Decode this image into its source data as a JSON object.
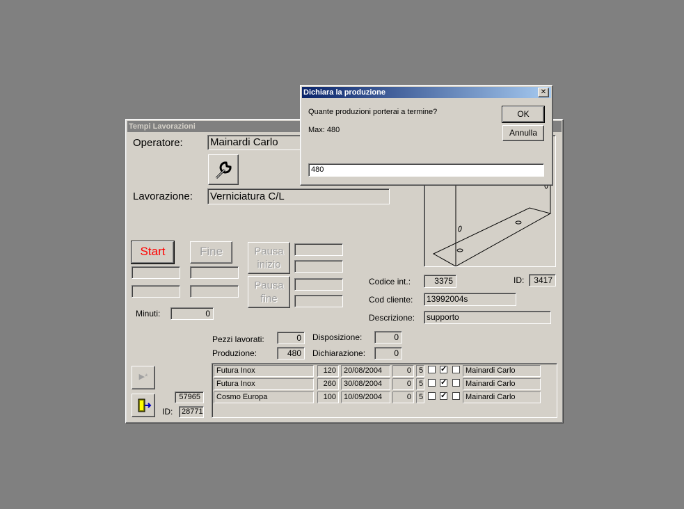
{
  "main": {
    "title": "Tempi Lavorazioni",
    "operatore_label": "Operatore:",
    "operatore_value": "Mainardi Carlo",
    "lavorazione_label": "Lavorazione:",
    "lavorazione_value": "Verniciatura C/L",
    "start_label": "Start",
    "fine_label": "Fine",
    "pausa_inizio_label": "Pausa\ninizio",
    "pausa_fine_label": "Pausa\nfine",
    "minuti_label": "Minuti:",
    "minuti_value": "0",
    "codice_int_label": "Codice  int.:",
    "codice_int_value": "3375",
    "id_label": "ID:",
    "id_value": "3417",
    "cod_cliente_label": "Cod cliente:",
    "cod_cliente_value": "13992004s",
    "descrizione_label": "Descrizione:",
    "descrizione_value": "supporto",
    "pezzi_label": "Pezzi lavorati:",
    "pezzi_value": "0",
    "produzione_label": "Produzione:",
    "produzione_value": "480",
    "disposizione_label": "Disposizione:",
    "disposizione_value": "0",
    "dichiarazione_label": "Dichiarazione:",
    "dichiarazione_value": "0",
    "record_value": "57965",
    "record_id_label": "ID:",
    "record_id_value": "28771",
    "rows": [
      {
        "cliente": "Futura Inox",
        "qty": "120",
        "date": "20/08/2004",
        "a": "0",
        "b": "5",
        "c1": false,
        "c2": true,
        "c3": false,
        "op": "Mainardi Carlo"
      },
      {
        "cliente": "Futura Inox",
        "qty": "260",
        "date": "30/08/2004",
        "a": "0",
        "b": "5",
        "c1": false,
        "c2": true,
        "c3": false,
        "op": "Mainardi Carlo"
      },
      {
        "cliente": "Cosmo Europa",
        "qty": "100",
        "date": "10/09/2004",
        "a": "0",
        "b": "5",
        "c1": false,
        "c2": true,
        "c3": false,
        "op": "Mainardi Carlo"
      }
    ]
  },
  "dialog": {
    "title": "Dichiara la produzione",
    "question": "Quante produzioni porterai a termine?",
    "max": "Max: 480",
    "ok_label": "OK",
    "cancel_label": "Annulla",
    "input_value": "480",
    "close_glyph": "✕"
  },
  "check_glyph": "✓",
  "icons": {
    "wrench": "wrench-icon",
    "nav": "next-new-record-icon",
    "exit": "exit-door-icon"
  }
}
